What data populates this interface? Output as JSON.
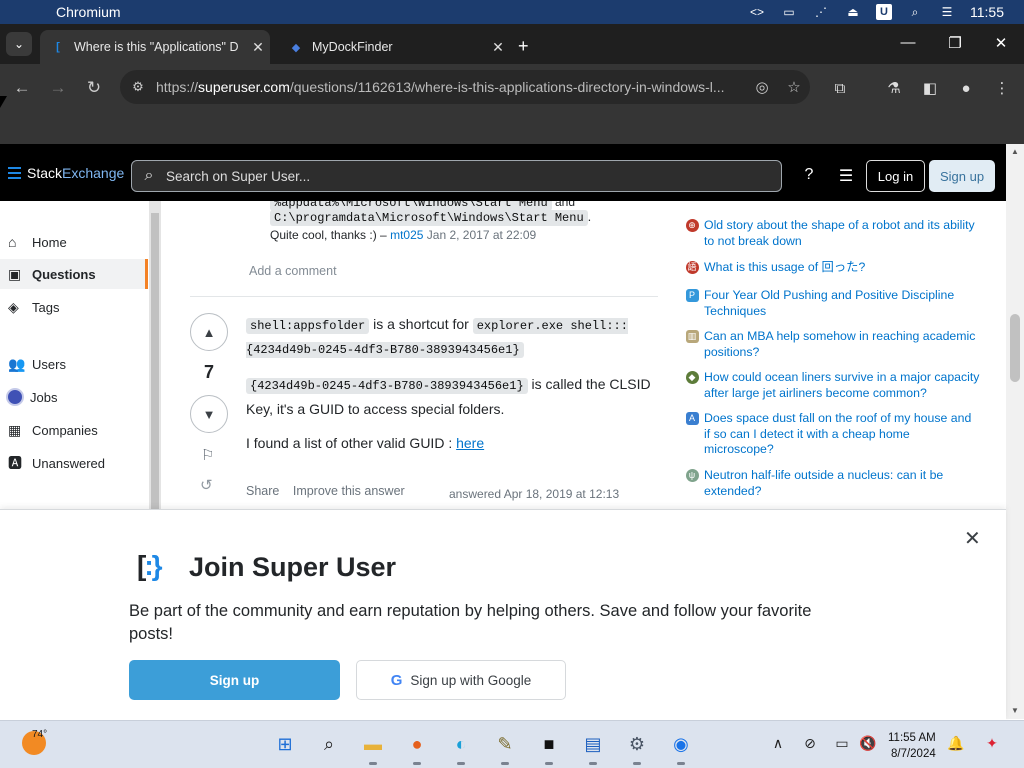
{
  "mac_menubar": {
    "app_name": "Chromium",
    "time": "11:55"
  },
  "browser": {
    "tabs": [
      {
        "title": "Where is this \"Applications\" D",
        "active": true
      },
      {
        "title": "MyDockFinder",
        "active": false
      }
    ],
    "url_prefix": "https://",
    "url_host": "superuser.com",
    "url_path": "/questions/1162613/where-is-this-applications-directory-in-windows-l..."
  },
  "se_header": {
    "logo_stack": "Stack",
    "logo_exchange": "Exchange",
    "search_placeholder": "Search on Super User...",
    "login_label": "Log in",
    "signup_label": "Sign up"
  },
  "left_nav": {
    "items": [
      {
        "label": "Home",
        "icon": "home-icon",
        "active": false
      },
      {
        "label": "Questions",
        "icon": "questions-icon",
        "active": true
      },
      {
        "label": "Tags",
        "icon": "tag-icon",
        "active": false
      },
      {
        "label": "Users",
        "icon": "users-icon",
        "active": false
      },
      {
        "label": "Jobs",
        "icon": "jobs-icon",
        "active": false
      },
      {
        "label": "Companies",
        "icon": "companies-icon",
        "active": false
      },
      {
        "label": "Unanswered",
        "icon": "unanswered-icon",
        "active": false
      }
    ]
  },
  "comment": {
    "code_top": "%appdata%\\Microsoft\\Windows\\Start Menu",
    "and_text": "and",
    "code_2": "C:\\programdata\\Microsoft\\Windows\\Start Menu",
    "period": ".",
    "text": "Quite cool, thanks :) –",
    "user": "mt025",
    "date": "Jan 2, 2017 at 22:09",
    "add_comment": "Add a comment"
  },
  "answer": {
    "votes": "7",
    "code_1": "shell:appsfolder",
    "text_1": "is a shortcut for",
    "code_2": "explorer.exe shell:::{4234d49b-0245-4df3-B780-3893943456e1}",
    "code_3": "{4234d49b-0245-4df3-B780-3893943456e1}",
    "text_2a": "is called the",
    "text_2b": "CLSID Key, it's a GUID to access special folders.",
    "text_3": "I found a list of other valid GUID :",
    "link_here": "here",
    "share": "Share",
    "improve": "Improve this answer",
    "answered": "answered Apr 18, 2019 at 12:13"
  },
  "hot_network_questions": [
    {
      "title": "Old story about the shape of a robot and its ability to not break down",
      "color": "#c0392b"
    },
    {
      "title": "What is this usage of 回った?",
      "color": "#c0392b"
    },
    {
      "title": "Four Year Old Pushing and Positive Discipline Techniques",
      "color": "#3498db"
    },
    {
      "title": "Can an MBA help somehow in reaching academic positions?",
      "color": "#8e7d5a"
    },
    {
      "title": "How could ocean liners survive in a major capacity after large jet airliners become common?",
      "color": "#5d7c3a"
    },
    {
      "title": "Does space dust fall on the roof of my house and if so can I detect it with a cheap home microscope?",
      "color": "#3a7fd0"
    },
    {
      "title": "Neutron half-life outside a nucleus: can it be extended?",
      "color": "#7fa38c"
    }
  ],
  "signup_modal": {
    "title": "Join Super User",
    "body": "Be part of the community and earn reputation by helping others. Save and follow your favorite posts!",
    "signup_label": "Sign up",
    "google_label": "Sign up with Google"
  },
  "taskbar": {
    "temperature": "74°",
    "time": "11:55 AM",
    "date": "8/7/2024"
  }
}
